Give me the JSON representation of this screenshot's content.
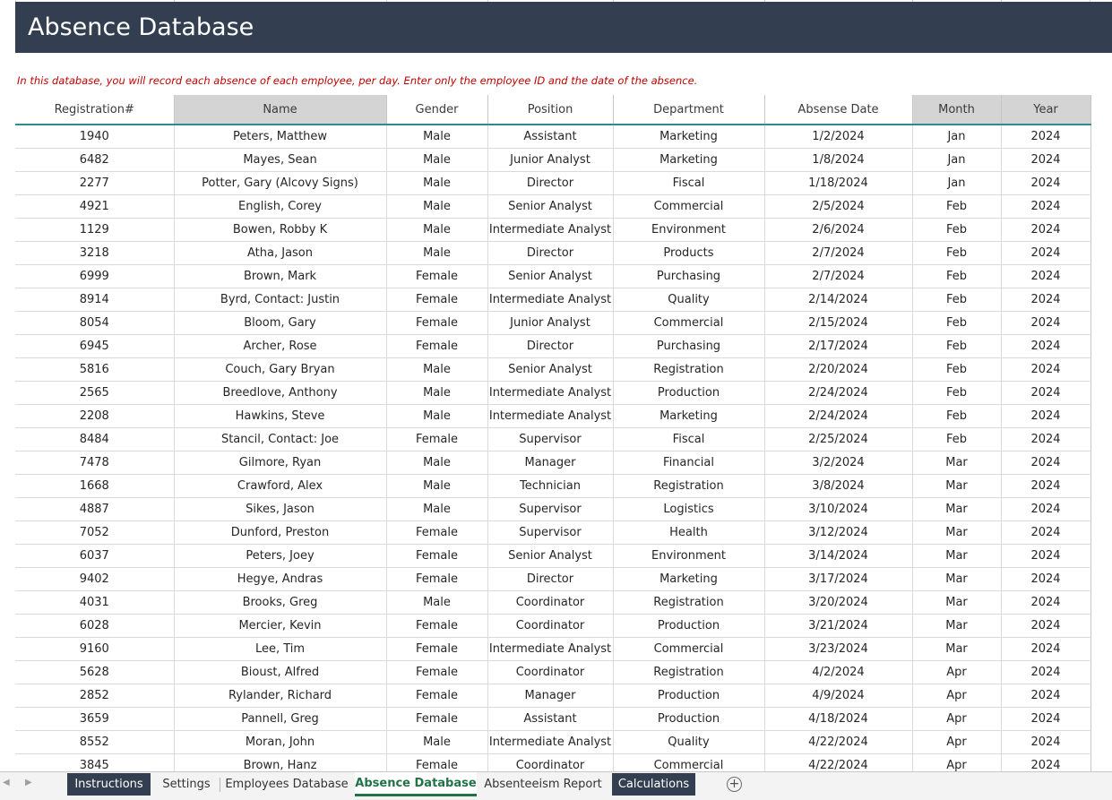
{
  "title": "Absence Database",
  "instruction": "In this database, you will record each absence of each employee, per day. Enter only the employee ID and the date of the absence.",
  "columns": [
    "Registration#",
    "Name",
    "Gender",
    "Position",
    "Department",
    "Absense Date",
    "Month",
    "Year"
  ],
  "rows": [
    [
      "1940",
      "Peters, Matthew",
      "Male",
      "Assistant",
      "Marketing",
      "1/2/2024",
      "Jan",
      "2024"
    ],
    [
      "6482",
      "Mayes, Sean",
      "Male",
      "Junior Analyst",
      "Marketing",
      "1/8/2024",
      "Jan",
      "2024"
    ],
    [
      "2277",
      "Potter, Gary (Alcovy Signs)",
      "Male",
      "Director",
      "Fiscal",
      "1/18/2024",
      "Jan",
      "2024"
    ],
    [
      "4921",
      "English, Corey",
      "Male",
      "Senior Analyst",
      "Commercial",
      "2/5/2024",
      "Feb",
      "2024"
    ],
    [
      "1129",
      "Bowen, Robby K",
      "Male",
      "Intermediate Analyst",
      "Environment",
      "2/6/2024",
      "Feb",
      "2024"
    ],
    [
      "3218",
      "Atha, Jason",
      "Male",
      "Director",
      "Products",
      "2/7/2024",
      "Feb",
      "2024"
    ],
    [
      "6999",
      "Brown, Mark",
      "Female",
      "Senior Analyst",
      "Purchasing",
      "2/7/2024",
      "Feb",
      "2024"
    ],
    [
      "8914",
      "Byrd, Contact: Justin",
      "Female",
      "Intermediate Analyst",
      "Quality",
      "2/14/2024",
      "Feb",
      "2024"
    ],
    [
      "8054",
      "Bloom, Gary",
      "Female",
      "Junior Analyst",
      "Commercial",
      "2/15/2024",
      "Feb",
      "2024"
    ],
    [
      "6945",
      "Archer, Rose",
      "Female",
      "Director",
      "Purchasing",
      "2/17/2024",
      "Feb",
      "2024"
    ],
    [
      "5816",
      "Couch, Gary Bryan",
      "Male",
      "Senior Analyst",
      "Registration",
      "2/20/2024",
      "Feb",
      "2024"
    ],
    [
      "2565",
      "Breedlove, Anthony",
      "Male",
      "Intermediate Analyst",
      "Production",
      "2/24/2024",
      "Feb",
      "2024"
    ],
    [
      "2208",
      "Hawkins, Steve",
      "Male",
      "Intermediate Analyst",
      "Marketing",
      "2/24/2024",
      "Feb",
      "2024"
    ],
    [
      "8484",
      "Stancil, Contact: Joe",
      "Female",
      "Supervisor",
      "Fiscal",
      "2/25/2024",
      "Feb",
      "2024"
    ],
    [
      "7478",
      "Gilmore, Ryan",
      "Male",
      "Manager",
      "Financial",
      "3/2/2024",
      "Mar",
      "2024"
    ],
    [
      "1668",
      "Crawford, Alex",
      "Male",
      "Technician",
      "Registration",
      "3/8/2024",
      "Mar",
      "2024"
    ],
    [
      "4887",
      "Sikes, Jason",
      "Male",
      "Supervisor",
      "Logistics",
      "3/10/2024",
      "Mar",
      "2024"
    ],
    [
      "7052",
      "Dunford, Preston",
      "Female",
      "Supervisor",
      "Health",
      "3/12/2024",
      "Mar",
      "2024"
    ],
    [
      "6037",
      "Peters, Joey",
      "Female",
      "Senior Analyst",
      "Environment",
      "3/14/2024",
      "Mar",
      "2024"
    ],
    [
      "9402",
      "Hegye, Andras",
      "Female",
      "Director",
      "Marketing",
      "3/17/2024",
      "Mar",
      "2024"
    ],
    [
      "4031",
      "Brooks, Greg",
      "Male",
      "Coordinator",
      "Registration",
      "3/20/2024",
      "Mar",
      "2024"
    ],
    [
      "6028",
      "Mercier, Kevin",
      "Female",
      "Coordinator",
      "Production",
      "3/21/2024",
      "Mar",
      "2024"
    ],
    [
      "9160",
      "Lee, Tim",
      "Female",
      "Intermediate Analyst",
      "Commercial",
      "3/23/2024",
      "Mar",
      "2024"
    ],
    [
      "5628",
      "Bioust, Alfred",
      "Female",
      "Coordinator",
      "Registration",
      "4/2/2024",
      "Apr",
      "2024"
    ],
    [
      "2852",
      "Rylander, Richard",
      "Female",
      "Manager",
      "Production",
      "4/9/2024",
      "Apr",
      "2024"
    ],
    [
      "3659",
      "Pannell, Greg",
      "Female",
      "Assistant",
      "Production",
      "4/18/2024",
      "Apr",
      "2024"
    ],
    [
      "8552",
      "Moran, John",
      "Male",
      "Intermediate Analyst",
      "Quality",
      "4/22/2024",
      "Apr",
      "2024"
    ],
    [
      "3845",
      "Brown, Hanz",
      "Female",
      "Coordinator",
      "Commercial",
      "4/22/2024",
      "Apr",
      "2024"
    ]
  ],
  "tabs": [
    {
      "label": "Instructions",
      "style": "dark"
    },
    {
      "label": "Settings",
      "style": "normal"
    },
    {
      "label": "Employees Database",
      "style": "normal"
    },
    {
      "label": "Absence Database",
      "style": "active"
    },
    {
      "label": "Absenteeism Report",
      "style": "normal"
    },
    {
      "label": "Calculations",
      "style": "dark"
    }
  ],
  "nav_icons": [
    "scroll-left-icon",
    "scroll-right-icon",
    "add-sheet-icon"
  ],
  "colors": {
    "banner": "#333f50",
    "instruction_text": "#c00000",
    "header_grey": "#d4d4d4",
    "header_underline": "#2e8b91",
    "active_tab": "#217346"
  }
}
